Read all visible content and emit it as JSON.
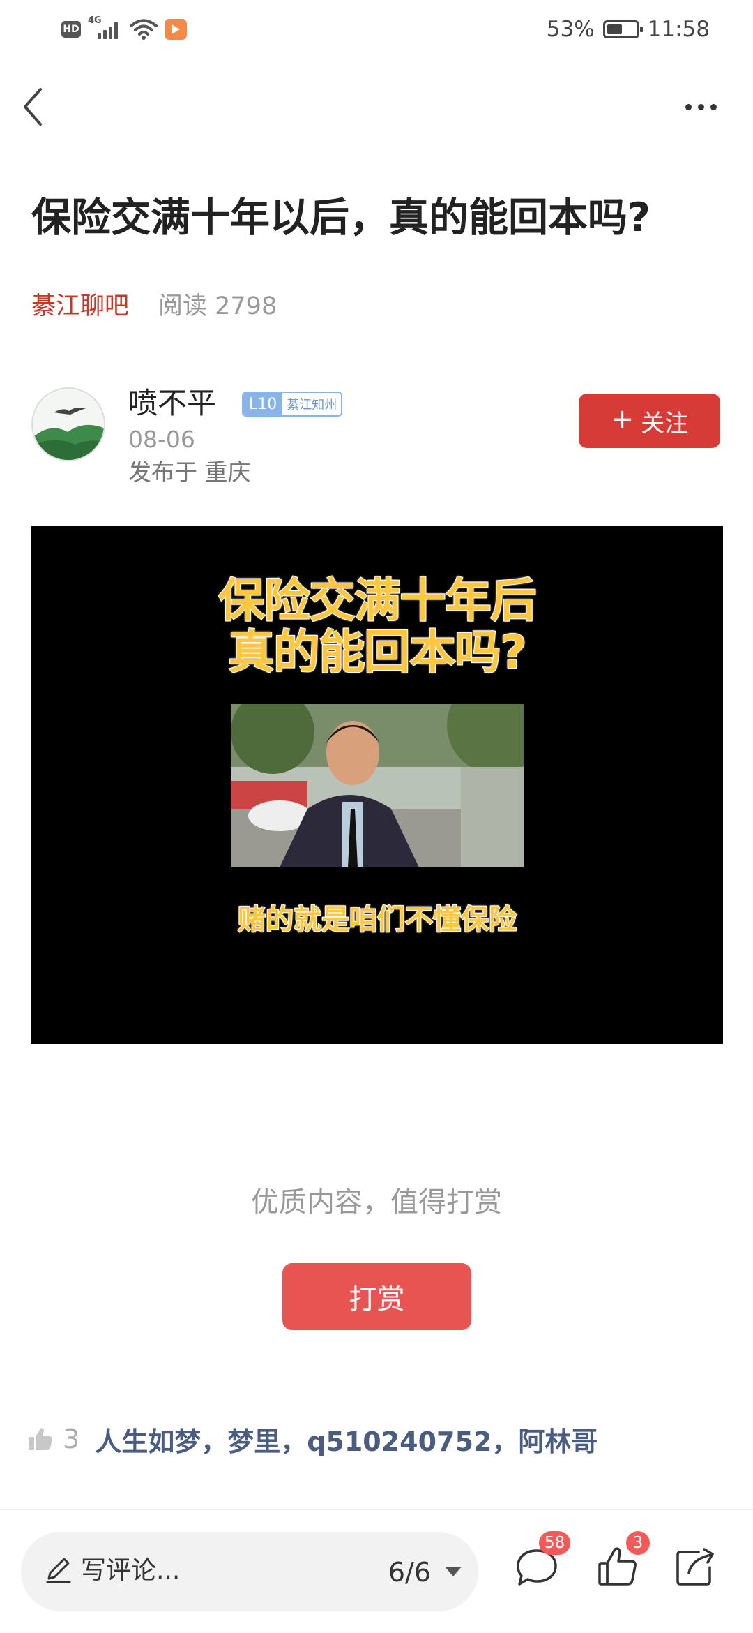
{
  "status_bar": {
    "hd": "HD",
    "network": "4G",
    "battery_percent": "53%",
    "battery_level": 0.53,
    "time": "11:58"
  },
  "nav": {
    "back_icon": "chevron-left-icon",
    "more_icon": "more-dots-icon"
  },
  "article": {
    "title": "保险交满十年以后，真的能回本吗?",
    "forum": "綦江聊吧",
    "reads": "阅读 2798"
  },
  "author": {
    "name": "喷不平",
    "level": "L10",
    "group": "綦江知州",
    "date": "08-06",
    "location": "发布于 重庆",
    "follow_label": "关注",
    "follow_icon": "plus-icon"
  },
  "video": {
    "caption_line1": "保险交满十年后",
    "caption_line2": "真的能回本吗?",
    "subtitle": "赌的就是咱们不懂保险"
  },
  "reward": {
    "prompt": "优质内容，值得打赏",
    "button": "打赏"
  },
  "likes": {
    "count": "3",
    "names": "人生如梦，梦里，q510240752，阿林哥"
  },
  "bottom_bar": {
    "comment_placeholder": "写评论...",
    "page_indicator": "6/6",
    "comment_count": "58",
    "like_count": "3"
  },
  "colors": {
    "accent_red": "#d63b38",
    "reward_red": "#e85451",
    "forum_red": "#c0392b",
    "name_blue": "#4a5d80",
    "caption_yellow": "#ffc640"
  }
}
